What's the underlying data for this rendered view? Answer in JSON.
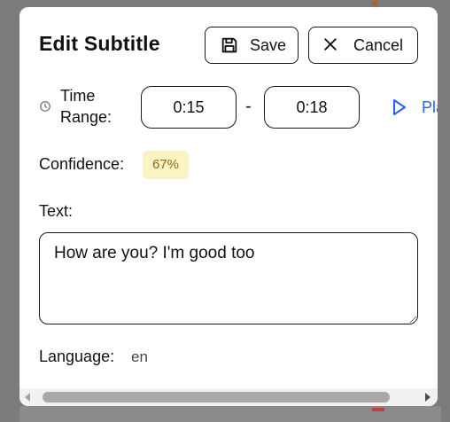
{
  "dialog": {
    "title": "Edit Subtitle",
    "save_label": "Save",
    "cancel_label": "Cancel"
  },
  "time_range": {
    "label": "Time Range:",
    "start": "0:15",
    "separator": "-",
    "end": "0:18",
    "play_label": "Play"
  },
  "confidence": {
    "label": "Confidence:",
    "value": "67%",
    "badge_bg": "#fcf3c4",
    "badge_fg": "#8a6a1e"
  },
  "text": {
    "label": "Text:",
    "value": "How are you? I'm good too"
  },
  "language": {
    "label": "Language:",
    "value": "en"
  },
  "colors": {
    "accent": "#2563eb",
    "backdrop": "#7b7b7b"
  },
  "icons": {
    "save": "floppy-disk",
    "cancel": "x-mark",
    "time": "clock",
    "play": "play-triangle"
  }
}
